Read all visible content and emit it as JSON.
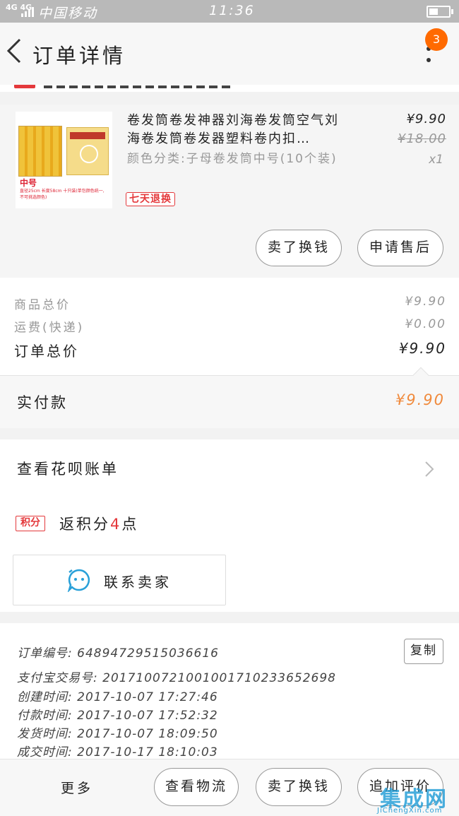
{
  "status_bar": {
    "network": "4G 4G",
    "carrier": "中国移动",
    "time": "11:36",
    "battery_level": 0.45
  },
  "nav": {
    "title": "订单详情",
    "badge_count": "3"
  },
  "product": {
    "name": "卷发筒卷发神器刘海卷发筒空气刘海卷发筒卷发器塑料卷内扣…",
    "variant": "颜色分类:子母卷发筒中号(10个装)",
    "return_tag": "七天退换",
    "price": "¥9.90",
    "original_price": "¥18.00",
    "quantity": "x1",
    "thumb_size_label": "中号",
    "thumb_small_text": "直径25cm 长度58cm 十只装(单包颜色统一, 不可挑选颜色)",
    "actions": {
      "sell_swap": "卖了换钱",
      "after_sales": "申请售后"
    }
  },
  "totals": {
    "goods_label": "商品总价",
    "goods_value": "¥9.90",
    "shipping_label": "运费(快递)",
    "shipping_value": "¥0.00",
    "order_total_label": "订单总价",
    "order_total_value": "¥9.90",
    "paid_label": "实付款",
    "paid_value": "¥9.90"
  },
  "colors": {
    "accent_orange": "#ff6a00",
    "paid_orange": "#f08a3c",
    "tag_red": "#e4393c",
    "contact_blue": "#29a0d8"
  },
  "huabei": {
    "label": "查看花呗账单"
  },
  "points": {
    "tag": "积分",
    "prefix": "返积分",
    "number": "4",
    "suffix": "点"
  },
  "contact": {
    "label": "联系卖家"
  },
  "order_info": {
    "order_no": "订单编号: 64894729515036616",
    "alipay_no": "支付宝交易号: 2017100721001001710233652698",
    "created": "创建时间: 2017-10-07 17:27:46",
    "paid": "付款时间: 2017-10-07 17:52:32",
    "shipped": "发货时间: 2017-10-07 18:09:50",
    "completed": "成交时间: 2017-10-17 18:10:03",
    "copy_label": "复制"
  },
  "bottom_bar": {
    "more": "更多",
    "logistics": "查看物流",
    "sell_swap": "卖了换钱",
    "review": "追加评价"
  },
  "watermark": {
    "logo": "集成网",
    "url": "JiChengXin.com"
  }
}
